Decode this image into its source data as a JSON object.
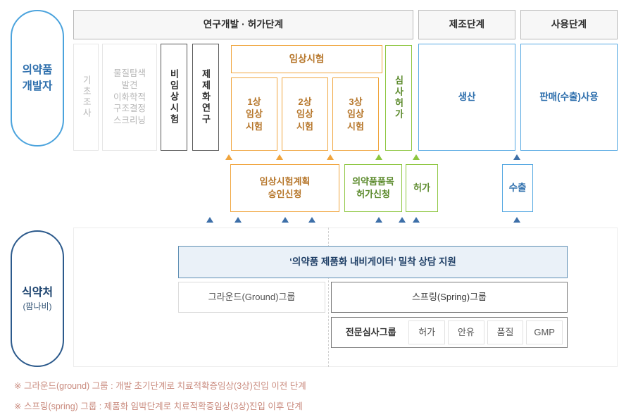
{
  "roles": {
    "developer": {
      "line1": "의약품",
      "line2": "개발자"
    },
    "mfds": {
      "name": "식약처",
      "sub": "(팜나비)"
    }
  },
  "stage_headers": [
    {
      "label": "연구개발 · 허가단계"
    },
    {
      "label": "제조단계"
    },
    {
      "label": "사용단계"
    }
  ],
  "developer_lane": {
    "basic_research": "기초조사",
    "discovery": "물질탐색\n발견\n이화학적\n구조결정\n스크리닝",
    "nonclinical": "비임상시험",
    "formulation": "제제화연구",
    "clinical_header": "임상시험",
    "phases": [
      {
        "label": "1상\n임상\n시험"
      },
      {
        "label": "2상\n임상\n시험"
      },
      {
        "label": "3상\n임상\n시험"
      }
    ],
    "review_approval": "심사허가",
    "production": "생산",
    "sales": "판매(수출)사용"
  },
  "applications": [
    {
      "label": "임상시험계획\n승인신청",
      "color": "#f0a53e"
    },
    {
      "label": "의약품품목\n허가신청",
      "color": "#8dc63f"
    },
    {
      "label": "허가",
      "color": "#8dc63f"
    },
    {
      "label": "수출",
      "color": "#55a8e2"
    }
  ],
  "mfds_panel": {
    "navigator": "‘의약품 제품화 내비게이터’ 밀착 상담 지원",
    "ground_group": "그라운드(Ground)그룹",
    "spring_group": "스프링(Spring)그룹",
    "review_group_label": "전문심사그룹",
    "review_cells": [
      "허가",
      "안유",
      "품질",
      "GMP"
    ]
  },
  "footnotes": [
    "※ 그라운드(ground) 그룹 : 개발 초기단계로 치료적확증임상(3상)진입 이전 단계",
    "※ 스프링(spring) 그룹 : 제품화 임박단계로 치료적확증임상(3상)진입 이후 단계"
  ],
  "colors": {
    "orange": "#f0a53e",
    "green": "#8dc63f",
    "blue": "#55a8e2",
    "navy": "#2c5a8c",
    "arrow_blue": "#3d6fa8",
    "note_text": "#c98a7d"
  }
}
